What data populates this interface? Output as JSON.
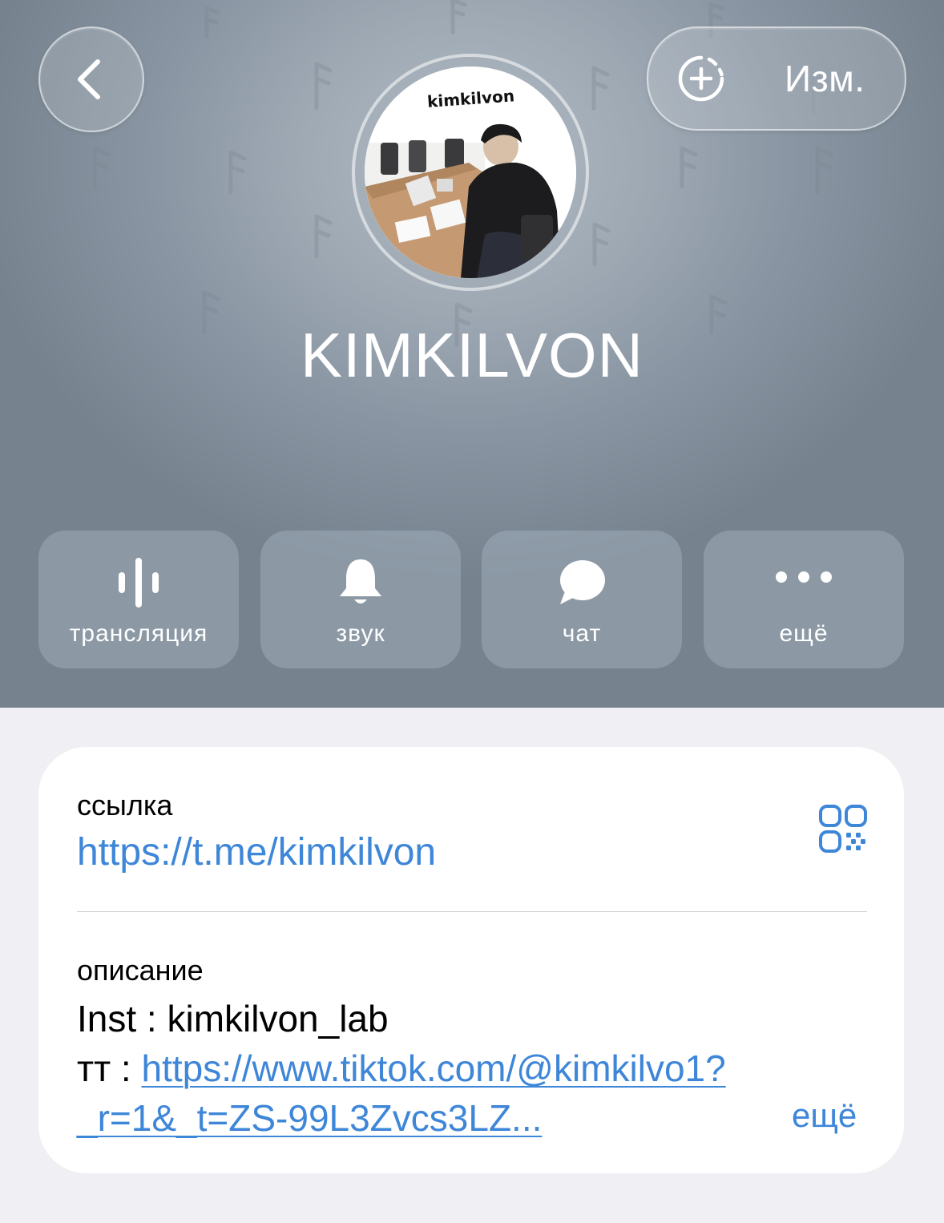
{
  "header": {
    "edit_label": "Изм.",
    "channel_name": "KIMKILVON",
    "avatar_logo_text": "kimkilvon"
  },
  "actions": [
    {
      "label": "трансляция",
      "icon": "live-stream-icon"
    },
    {
      "label": "звук",
      "icon": "bell-icon"
    },
    {
      "label": "чат",
      "icon": "chat-bubble-icon"
    },
    {
      "label": "ещё",
      "icon": "more-dots-icon"
    }
  ],
  "info": {
    "link_caption": "ссылка",
    "link_value": "https://t.me/kimkilvon",
    "description_caption": "описание",
    "description_line1": "Inst : kimkilvon_lab",
    "description_line2_prefix": "тт : ",
    "description_line2_link": "https://www.tiktok.com/@kimkilvo1?",
    "description_line3_link": "_r=1&_t=ZS-99L3Zvcs3LZ...",
    "more_label": "ещё"
  },
  "colors": {
    "accent": "#3e86d8",
    "background": "#efeff4",
    "header_gray": "#8995a2"
  }
}
